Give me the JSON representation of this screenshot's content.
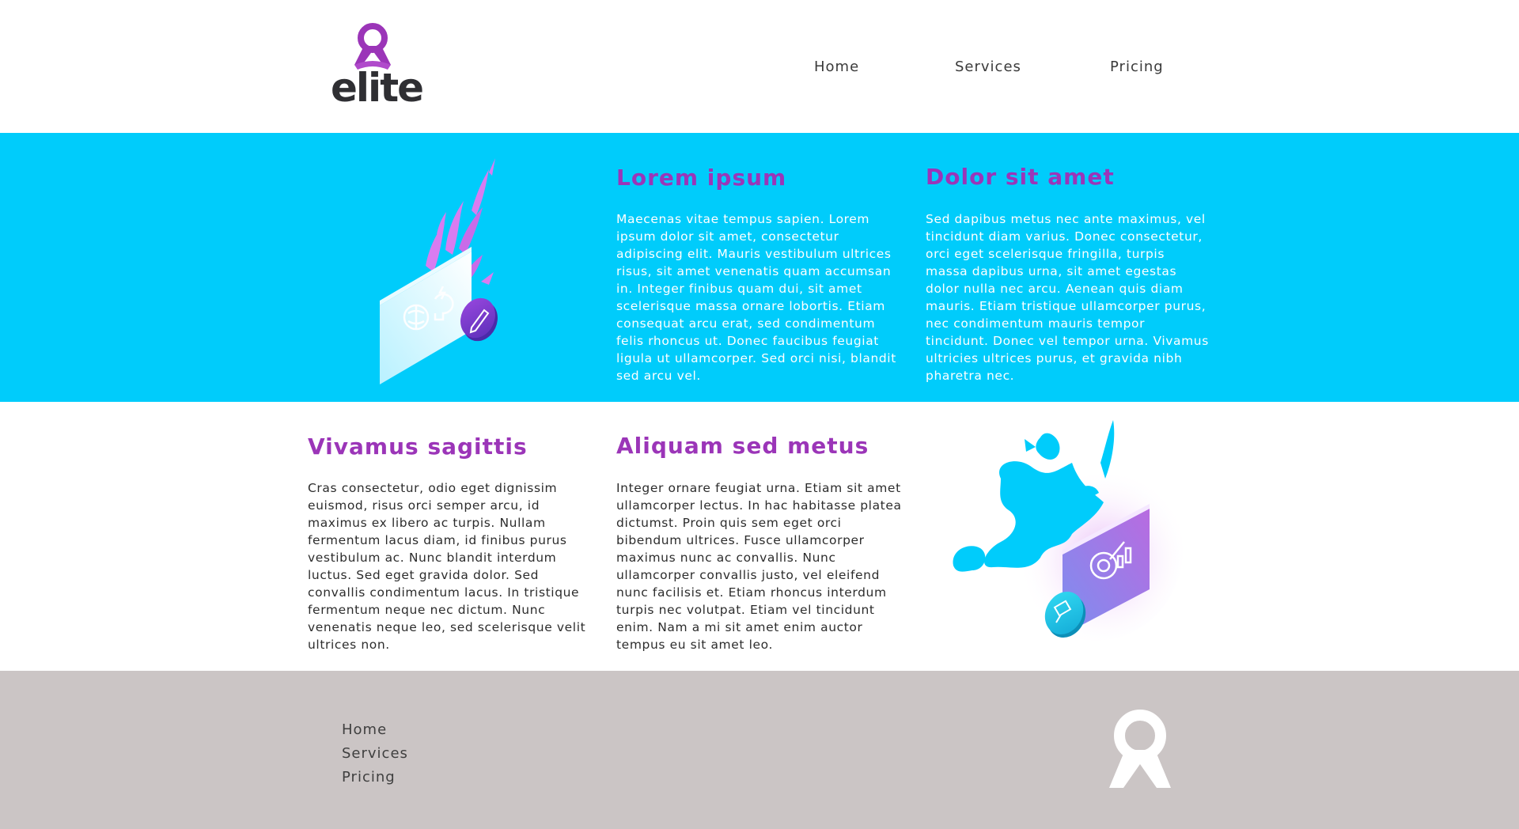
{
  "brand": {
    "name": "elite",
    "purple": "#9b35b8",
    "cyan": "#00ccfb"
  },
  "nav": {
    "items": [
      "Home",
      "Services",
      "Pricing"
    ]
  },
  "features": [
    {
      "title": "Lorem ipsum",
      "text": "Maecenas vitae tempus sapien. Lorem ipsum dolor sit amet, consectetur adipiscing elit. Mauris vestibulum ultrices risus, sit amet venenatis quam accumsan in. Integer finibus quam dui, sit amet scelerisque massa ornare lobortis. Etiam consequat arcu erat, sed condimentum felis rhoncus ut. Donec faucibus feugiat ligula ut ullamcorper. Sed orci nisi, blandit sed arcu vel."
    },
    {
      "title": "Dolor sit amet",
      "text": "Sed dapibus metus nec ante maximus, vel tincidunt diam varius. Donec consectetur, orci eget scelerisque fringilla, turpis massa dapibus urna, sit amet egestas dolor nulla nec arcu. Aenean quis diam mauris. Etiam tristique ullamcorper purus, nec condimentum mauris tempor tincidunt. Donec vel tempor urna. Vivamus ultricies ultrices purus, et gravida nibh pharetra nec."
    },
    {
      "title": "Vivamus sagittis",
      "text": "Cras consectetur, odio eget dignissim euismod, risus orci semper arcu, id maximus ex libero ac turpis. Nullam fermentum lacus diam, id finibus purus vestibulum ac. Nunc blandit interdum luctus. Sed eget gravida dolor. Sed convallis condimentum lacus. In tristique fermentum neque nec dictum. Nunc venenatis neque leo, sed scelerisque velit ultrices non."
    },
    {
      "title": "Aliquam sed metus",
      "text": "Integer ornare feugiat urna. Etiam sit amet ullamcorper lectus. In hac habitasse platea dictumst. Proin quis sem eget orci bibendum ultrices. Fusce ullamcorper maximus nunc ac convallis. Nunc ullamcorper convallis justo, vel eleifend nunc facilisis et. Etiam rhoncus interdum turpis nec volutpat. Etiam vel tincidunt enim. Nam a mi sit amet enim auctor tempus eu sit amet leo."
    }
  ],
  "footer": {
    "links": [
      "Home",
      "Services",
      "Pricing"
    ]
  },
  "icons": {
    "logo": "ribbon-logo-icon",
    "illustration_1": "brain-idea-pencil-icon",
    "illustration_2": "target-chart-brush-icon",
    "footer_logo": "ribbon-logo-icon"
  }
}
